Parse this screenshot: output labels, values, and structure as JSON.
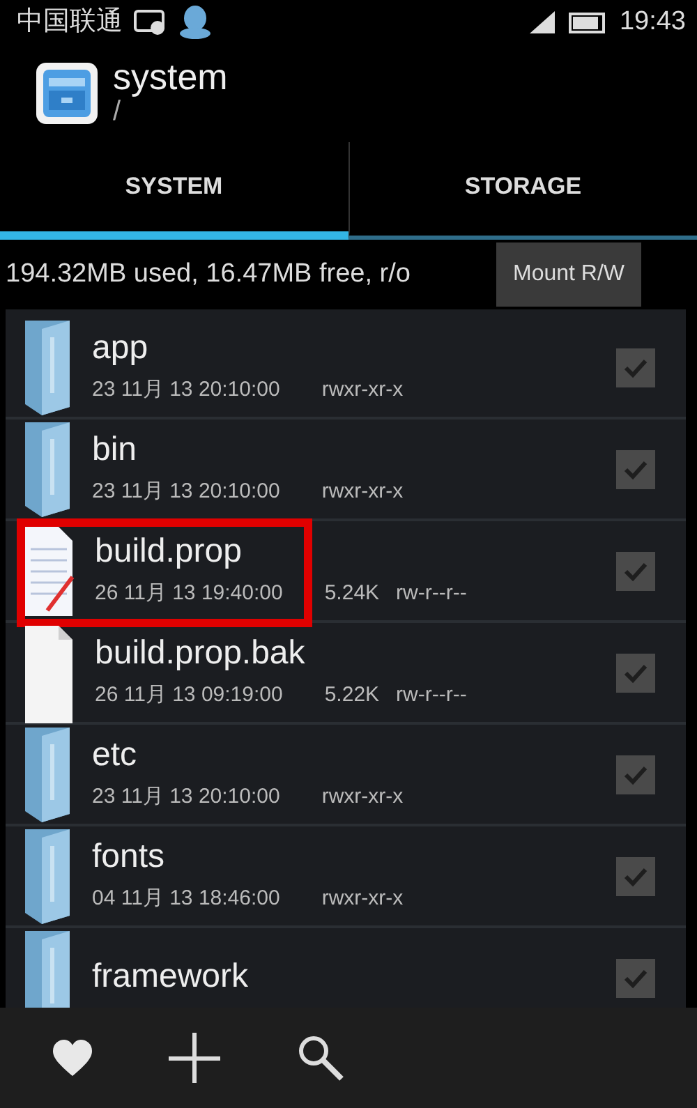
{
  "status_bar": {
    "carrier": "中国联通",
    "time": "19:43"
  },
  "header": {
    "title": "system",
    "path": "/"
  },
  "tabs": [
    {
      "label": "SYSTEM",
      "selected": true
    },
    {
      "label": "STORAGE",
      "selected": false
    }
  ],
  "info_bar": {
    "text": "194.32MB used, 16.47MB free, r/o",
    "button": "Mount R/W"
  },
  "files": [
    {
      "kind": "folder",
      "name": "app",
      "date": "23 11月 13 20:10:00",
      "perms": "rwxr-xr-x",
      "checked": true,
      "highlighted": false
    },
    {
      "kind": "folder",
      "name": "bin",
      "date": "23 11月 13 20:10:00",
      "perms": "rwxr-xr-x",
      "checked": true,
      "highlighted": false
    },
    {
      "kind": "text-file",
      "name": "build.prop",
      "date": "26 11月 13 19:40:00",
      "size": "5.24K",
      "perms": "rw-r--r--",
      "checked": true,
      "highlighted": true
    },
    {
      "kind": "file",
      "name": "build.prop.bak",
      "date": "26 11月 13 09:19:00",
      "size": "5.22K",
      "perms": "rw-r--r--",
      "checked": true,
      "highlighted": false
    },
    {
      "kind": "folder",
      "name": "etc",
      "date": "23 11月 13 20:10:00",
      "perms": "rwxr-xr-x",
      "checked": true,
      "highlighted": false
    },
    {
      "kind": "folder",
      "name": "fonts",
      "date": "04 11月 13 18:46:00",
      "perms": "rwxr-xr-x",
      "checked": true,
      "highlighted": false
    },
    {
      "kind": "folder",
      "name": "framework",
      "checked": true,
      "highlighted": false
    }
  ]
}
